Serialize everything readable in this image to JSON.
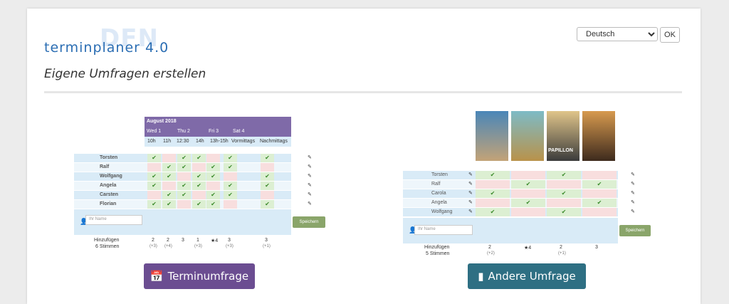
{
  "logo": {
    "ghost": "DFN",
    "text": "terminplaner 4.0"
  },
  "language": {
    "selected": "Deutsch",
    "ok_label": "OK"
  },
  "heading": "Eigene Umfragen erstellen",
  "left": {
    "month": "August 2018",
    "days": [
      "Wed 1",
      "Thu 2",
      "Fri 3",
      "Sat 4"
    ],
    "slots": [
      "10h",
      "11h",
      "12:30",
      "14h",
      "13h-15h",
      "Vormittags",
      "Nachmittags"
    ],
    "participants": [
      "Torsten",
      "Ralf",
      "Wolfgang",
      "Angela",
      "Carsten",
      "Florian"
    ],
    "name_placeholder": "Ihr Name",
    "save_label": "Speichern",
    "add_label": "Hinzufügen",
    "votes_label": "6 Stimmen",
    "totals": [
      "2",
      "2",
      "3",
      "1",
      "★4",
      "3",
      "3"
    ],
    "maybe": [
      "(+3)",
      "(+4)",
      "",
      "(+3)",
      "",
      "(+3)",
      "(+1)"
    ]
  },
  "right": {
    "participants": [
      "Torsten",
      "Ralf",
      "Carola",
      "Angela",
      "Wolfgang"
    ],
    "poster_label": "PAPILLON",
    "name_placeholder": "Ihr Name",
    "save_label": "Speichern",
    "add_label": "Hinzufügen",
    "votes_label": "5 Stimmen",
    "totals": [
      "2",
      "★4",
      "2",
      "3"
    ],
    "maybe": [
      "(+2)",
      "",
      "(+1)",
      ""
    ]
  },
  "buttons": {
    "poll": "Terminumfrage",
    "other": "Andere Umfrage"
  },
  "colors": {
    "purple": "#6b4d91",
    "teal": "#2e6f83",
    "yes": "#dcefd2",
    "no": "#f8dede",
    "name_bg": "#d9ebf7"
  }
}
